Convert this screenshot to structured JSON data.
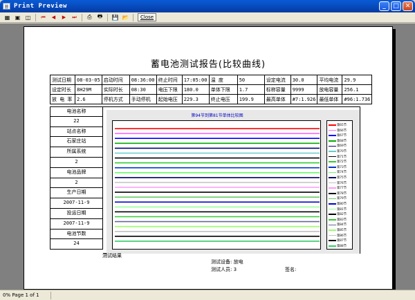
{
  "window": {
    "title": "Print Preview"
  },
  "toolbar": {
    "buttons": [
      "page-setup-icon",
      "one-page-icon",
      "two-page-icon",
      "first-page-icon",
      "prev-page-icon",
      "next-page-icon",
      "last-page-icon",
      "print-setup-icon",
      "print-icon",
      "save-icon",
      "open-icon"
    ],
    "close_label": "Close"
  },
  "report": {
    "title": "蓄电池测试报告(比较曲线)",
    "rows": [
      [
        "测试日期",
        "08-03-05",
        "启动时间",
        "08:36:00",
        "终止时间",
        "17:05:00",
        "温    度",
        "50",
        "设定电流",
        "30.0",
        "平均电流",
        "29.9"
      ],
      [
        "设定时长",
        "8H29M",
        "实际时长",
        "08:30",
        "电压下限",
        "180.0",
        "单体下限",
        "1.7",
        "标称容量",
        "9999",
        "放电容量",
        "256.1"
      ],
      [
        "放 电 率",
        "2.6",
        "停机方式",
        "手动停机",
        "起始电压",
        "229.3",
        "终止电压",
        "199.9",
        "最高单体",
        "#7:1.926",
        "最低单体",
        "#96:1.736"
      ]
    ],
    "left_column": [
      {
        "label": "电池名称",
        "value": "22"
      },
      {
        "label": "站点名称",
        "value": "石家庄站"
      },
      {
        "label": "所属系统",
        "value": "2"
      },
      {
        "label": "电池品牌",
        "value": "2"
      },
      {
        "label": "生产日期",
        "value": "2007-11-9"
      },
      {
        "label": "投运日期",
        "value": "2007-11-9"
      },
      {
        "label": "电池节数",
        "value": "24"
      }
    ],
    "result_label": "测试结果",
    "device_line": "测试设备: 放电",
    "tester_line": "测试人员: 3",
    "sign_label": "签名:"
  },
  "chart_data": {
    "type": "line",
    "title": "第94节到第81节单体比较图",
    "series": [
      {
        "name": "第65节",
        "color": "#ff0000",
        "values": [
          0.96,
          0.96,
          0.96,
          0.96
        ]
      },
      {
        "name": "第66节",
        "color": "#ff66ff",
        "values": [
          0.92,
          0.92,
          0.92,
          0.92
        ]
      },
      {
        "name": "第67节",
        "color": "#0000ff",
        "values": [
          0.88,
          0.88,
          0.88,
          0.88
        ]
      },
      {
        "name": "第68节",
        "color": "#00aa00",
        "values": [
          0.84,
          0.84,
          0.84,
          0.84
        ]
      },
      {
        "name": "第69节",
        "color": "#000080",
        "values": [
          0.8,
          0.8,
          0.8,
          0.8
        ]
      },
      {
        "name": "第70节",
        "color": "#66cccc",
        "values": [
          0.76,
          0.76,
          0.76,
          0.76
        ]
      },
      {
        "name": "第71节",
        "color": "#000000",
        "values": [
          0.72,
          0.72,
          0.72,
          0.72
        ]
      },
      {
        "name": "第72节",
        "color": "#33cc33",
        "values": [
          0.68,
          0.68,
          0.68,
          0.68
        ]
      },
      {
        "name": "第73节",
        "color": "#0033cc",
        "values": [
          0.64,
          0.64,
          0.64,
          0.64
        ]
      },
      {
        "name": "第74节",
        "color": "#66ff66",
        "values": [
          0.6,
          0.6,
          0.6,
          0.6
        ]
      },
      {
        "name": "第75节",
        "color": "#000066",
        "values": [
          0.56,
          0.56,
          0.56,
          0.56
        ]
      },
      {
        "name": "第76节",
        "color": "#c0c0c0",
        "values": [
          0.52,
          0.52,
          0.52,
          0.52
        ]
      },
      {
        "name": "第77节",
        "color": "#ff99ff",
        "values": [
          0.48,
          0.48,
          0.48,
          0.48
        ]
      },
      {
        "name": "第78节",
        "color": "#000000",
        "values": [
          0.44,
          0.44,
          0.44,
          0.44
        ]
      },
      {
        "name": "第79节",
        "color": "#66cc66",
        "values": [
          0.4,
          0.4,
          0.4,
          0.4
        ]
      },
      {
        "name": "第80节",
        "color": "#0000cc",
        "values": [
          0.36,
          0.36,
          0.36,
          0.36
        ]
      },
      {
        "name": "第81节",
        "color": "#99ff99",
        "values": [
          0.32,
          0.32,
          0.32,
          0.32
        ]
      },
      {
        "name": "第82节",
        "color": "#000000",
        "values": [
          0.28,
          0.28,
          0.28,
          0.28
        ]
      },
      {
        "name": "第83节",
        "color": "#33cc33",
        "values": [
          0.24,
          0.24,
          0.24,
          0.24
        ]
      },
      {
        "name": "第84节",
        "color": "#666699",
        "values": [
          0.2,
          0.2,
          0.2,
          0.2
        ]
      },
      {
        "name": "第85节",
        "color": "#99ff66",
        "values": [
          0.16,
          0.16,
          0.16,
          0.16
        ]
      },
      {
        "name": "第86节",
        "color": "#c0c0c0",
        "values": [
          0.12,
          0.12,
          0.12,
          0.12
        ]
      },
      {
        "name": "第87节",
        "color": "#000000",
        "values": [
          0.08,
          0.08,
          0.08,
          0.08
        ]
      },
      {
        "name": "第88节",
        "color": "#33cc66",
        "values": [
          0.04,
          0.04,
          0.04,
          0.04
        ]
      }
    ]
  },
  "status": {
    "zoom_page": "0%  Page 1 of 1"
  }
}
